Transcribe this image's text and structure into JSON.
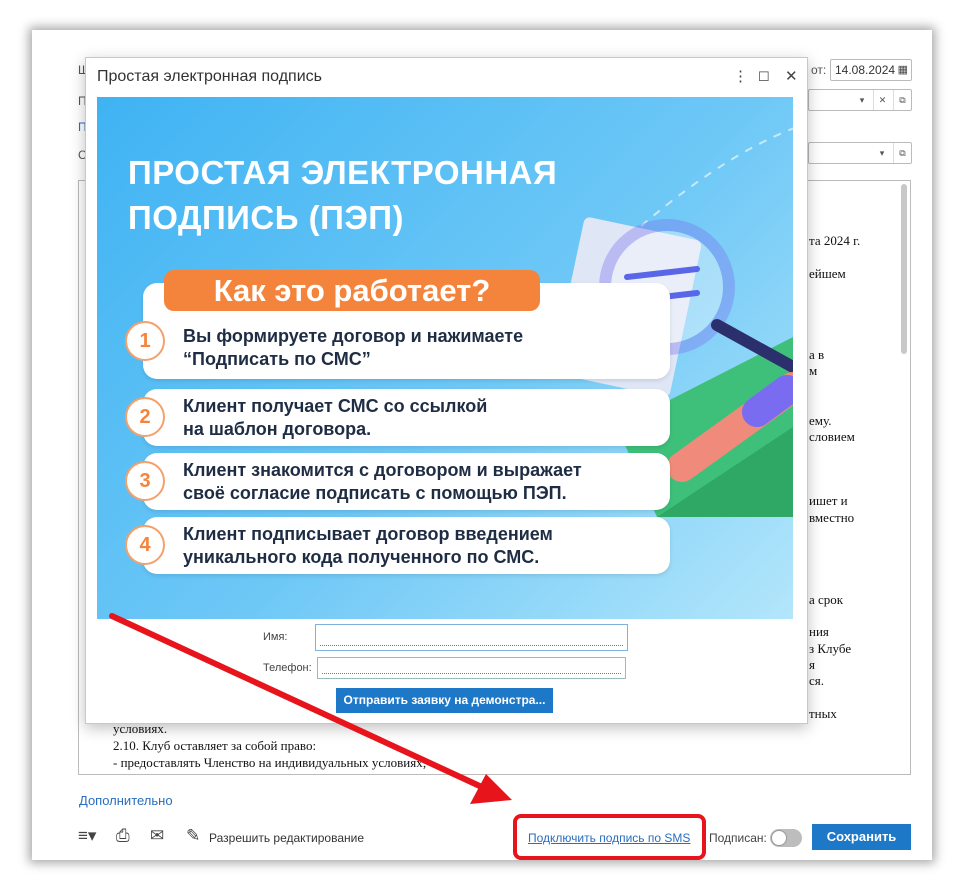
{
  "dialog": {
    "title": "Простая электронная подпись",
    "menu_icon": "⋮",
    "maximize_icon": "☐",
    "close_icon": "✕"
  },
  "banner": {
    "title_line1": "ПРОСТАЯ ЭЛЕКТРОННАЯ",
    "title_line2": "ПОДПИСЬ (ПЭП)",
    "subtitle": "Как это работает?",
    "steps": [
      {
        "num": "1",
        "line1": "Вы формируете договор и нажимаете",
        "line2": "“Подписать по СМС”"
      },
      {
        "num": "2",
        "line1": "Клиент получает СМС со ссылкой",
        "line2": "на шаблон договора."
      },
      {
        "num": "3",
        "line1": "Клиент знакомится с договором и выражает",
        "line2": "своё согласие подписать с помощью ПЭП."
      },
      {
        "num": "4",
        "line1": "Клиент подписывает договор введением",
        "line2": "уникального кода полученного по СМС."
      }
    ]
  },
  "form": {
    "name_label": "Имя:",
    "phone_label": "Телефон:",
    "submit_label": "Отправить заявку на демонстра..."
  },
  "background": {
    "date_label": "от:",
    "date_value": "14.08.2024",
    "doc_fragments": [
      "та 2024 г.",
      "ейшем",
      "а в",
      "м",
      "ему.",
      "словием",
      "ишет и",
      "вместно",
      "а срок",
      "ния",
      "з Клубе",
      "я",
      "ся.",
      "тных"
    ],
    "doc_lines": [
      "условиях.",
      "2.10. Клуб оставляет за собой право:",
      "- предоставлять Членство на индивидуальных условиях;"
    ]
  },
  "footer": {
    "more_link": "Дополнительно",
    "allow_edit": "Разрешить редактирование",
    "sms_link": "Подключить подпись по SMS",
    "signed_label": "Подписан:",
    "save_label": "Сохранить"
  },
  "colors": {
    "accent": "#1e78c8",
    "annotation": "#e8141c",
    "banner_orange": "#f4843b"
  }
}
